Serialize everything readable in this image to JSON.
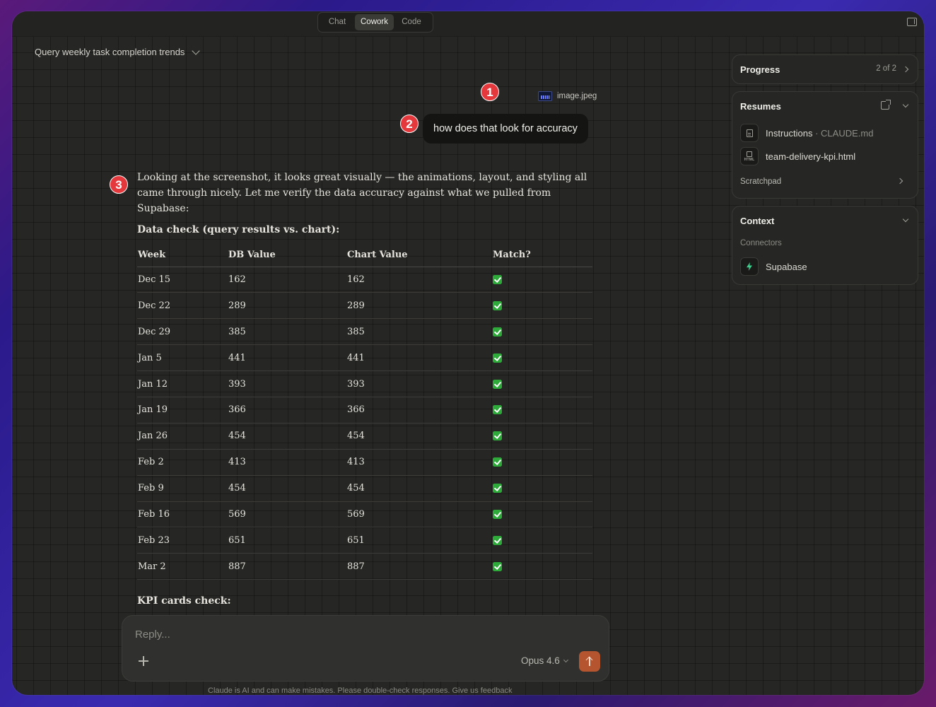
{
  "header": {
    "tabs": [
      {
        "label": "Chat",
        "active": false
      },
      {
        "label": "Cowork",
        "active": true
      },
      {
        "label": "Code",
        "active": false
      }
    ],
    "icons": {
      "sidebar_toggle": "sidebar-toggle-icon"
    }
  },
  "conversation": {
    "title": "Query weekly task completion trends"
  },
  "annotations": [
    "1",
    "2",
    "3"
  ],
  "messages": {
    "user": {
      "attachment_name": "image.jpeg",
      "text": "how does that look for accuracy"
    },
    "assistant": {
      "lead": "Looking at the screenshot, it looks great visually — the animations, layout, and styling all came through nicely. Let me verify the data accuracy against what we pulled from Supabase:",
      "heading": "Data check (query results vs. chart):",
      "table": {
        "headers": [
          "Week",
          "DB Value",
          "Chart Value",
          "Match?"
        ],
        "rows": [
          [
            "Dec 15",
            "162",
            "162"
          ],
          [
            "Dec 22",
            "289",
            "289"
          ],
          [
            "Dec 29",
            "385",
            "385"
          ],
          [
            "Jan 5",
            "441",
            "441"
          ],
          [
            "Jan 12",
            "393",
            "393"
          ],
          [
            "Jan 19",
            "366",
            "366"
          ],
          [
            "Jan 26",
            "454",
            "454"
          ],
          [
            "Feb 2",
            "413",
            "413"
          ],
          [
            "Feb 9",
            "454",
            "454"
          ],
          [
            "Feb 16",
            "569",
            "569"
          ],
          [
            "Feb 23",
            "651",
            "651"
          ],
          [
            "Mar 2",
            "887",
            "887"
          ]
        ],
        "match_icon": "green-check-icon"
      },
      "kpi_heading": "KPI cards check:"
    }
  },
  "composer": {
    "placeholder": "Reply...",
    "model": "Opus 4.6",
    "send_color": "#b5552f"
  },
  "disclaimer": "Claude is AI and can make mistakes. Please double-check responses. Give us feedback",
  "sidebar": {
    "progress": {
      "title": "Progress",
      "count": "2 of 2"
    },
    "resumes": {
      "title": "Resumes",
      "files": [
        {
          "name": "Instructions",
          "sep": " · ",
          "suffix": "CLAUDE.md"
        },
        {
          "name": "team-delivery-kpi.html"
        }
      ],
      "scratchpad": "Scratchpad"
    },
    "context": {
      "title": "Context",
      "subtitle": "Connectors",
      "connector": "Supabase",
      "connector_color": "#3ecf8e"
    }
  }
}
